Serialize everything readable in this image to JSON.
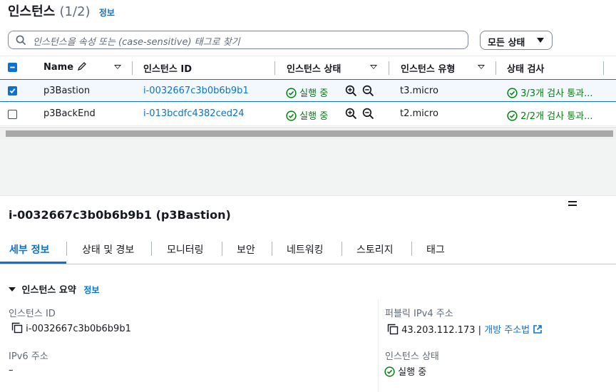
{
  "header": {
    "title": "인스턴스",
    "count": "(1/2)",
    "info": "정보"
  },
  "search": {
    "placeholder": "인스턴스을 속성 또는 (case-sensitive) 태그로 찾기"
  },
  "state_filter": {
    "label": "모든 상태"
  },
  "table": {
    "columns": [
      "Name",
      "인스턴스 ID",
      "인스턴스 상태",
      "인스턴스 유형",
      "상태 검사"
    ],
    "rows": [
      {
        "name": "p3Bastion",
        "instance_id": "i-0032667c3b0b6b9b1",
        "state": "실행 중",
        "type": "t3.micro",
        "checks": "3/3개 검사 통과...",
        "selected": true
      },
      {
        "name": "p3BackEnd",
        "instance_id": "i-013bcdfc4382ced24",
        "state": "실행 중",
        "type": "t2.micro",
        "checks": "2/2개 검사 통과...",
        "selected": false
      }
    ]
  },
  "detail": {
    "title": "i-0032667c3b0b6b9b1 (p3Bastion)",
    "tabs": [
      "세부 정보",
      "상태 및 경보",
      "모니터링",
      "보안",
      "네트워킹",
      "스토리지",
      "태그"
    ],
    "summary": {
      "heading": "인스턴스 요약",
      "info": "정보",
      "instance_id_label": "인스턴스 ID",
      "instance_id": "i-0032667c3b0b6b9b1",
      "ipv6_label": "IPv6 주소",
      "ipv6": "–",
      "public_ipv4_label": "퍼블릭 IPv4 주소",
      "public_ipv4": "43.203.112.173",
      "pipe": "|",
      "open_address": "개방 주소법",
      "state_label": "인스턴스 상태",
      "state": "실행 중"
    }
  },
  "colors": {
    "link": "#0972d3",
    "success": "#037f0c",
    "text": "#16191f",
    "muted": "#5f6b7a"
  }
}
